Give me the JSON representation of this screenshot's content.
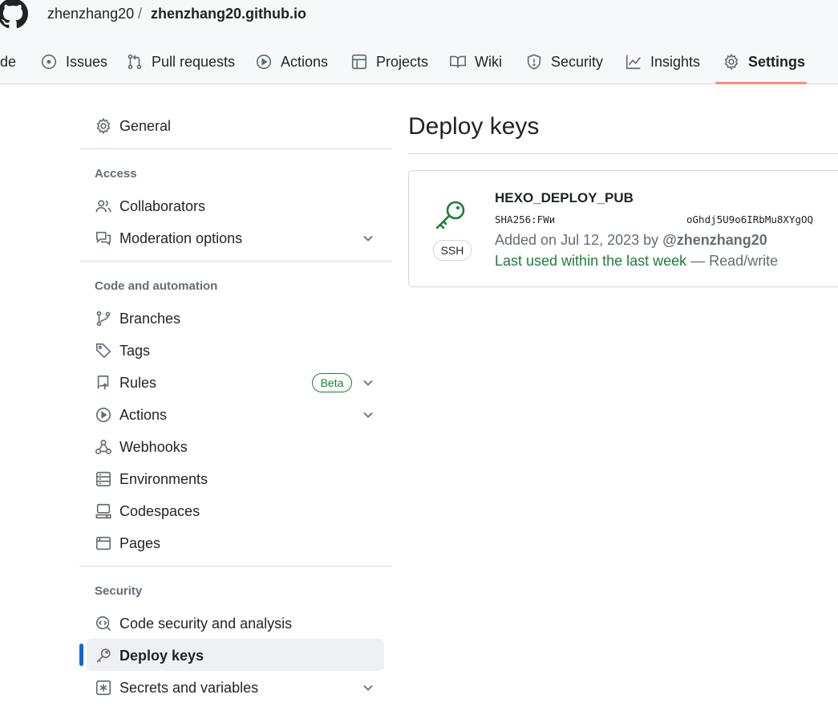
{
  "breadcrumb": {
    "owner": "zhenzhang20",
    "separator": "/",
    "repo": "zhenzhang20.github.io"
  },
  "tabs": [
    {
      "label": "de",
      "icon": "code-icon"
    },
    {
      "label": "Issues",
      "icon": "issue-icon"
    },
    {
      "label": "Pull requests",
      "icon": "pull-request-icon"
    },
    {
      "label": "Actions",
      "icon": "play-icon"
    },
    {
      "label": "Projects",
      "icon": "table-icon"
    },
    {
      "label": "Wiki",
      "icon": "book-icon"
    },
    {
      "label": "Security",
      "icon": "shield-icon"
    },
    {
      "label": "Insights",
      "icon": "graph-icon"
    },
    {
      "label": "Settings",
      "icon": "gear-icon",
      "active": true
    }
  ],
  "sidebar": {
    "general": "General",
    "access_heading": "Access",
    "collaborators": "Collaborators",
    "moderation": "Moderation options",
    "code_heading": "Code and automation",
    "branches": "Branches",
    "tags": "Tags",
    "rules": "Rules",
    "rules_badge": "Beta",
    "actions": "Actions",
    "webhooks": "Webhooks",
    "environments": "Environments",
    "codespaces": "Codespaces",
    "pages": "Pages",
    "security_heading": "Security",
    "code_security": "Code security and analysis",
    "deploy_keys": "Deploy keys",
    "secrets": "Secrets and variables"
  },
  "main": {
    "title": "Deploy keys",
    "key": {
      "name": "HEXO_DEPLOY_PUB",
      "badge": "SSH",
      "fingerprint_start": "SHA256:FWи",
      "fingerprint_end": "oGhdj5U9o6IRbMu8XYgOQ",
      "added_prefix": "Added on Jul 12, 2023 by",
      "added_user": "@zhenzhang20",
      "last_used": "Last used within the last week",
      "access": "— Read/write"
    }
  },
  "colors": {
    "accent_tab": "#fd8c73",
    "selected_bar": "#0969da",
    "success": "#1a7f37"
  }
}
